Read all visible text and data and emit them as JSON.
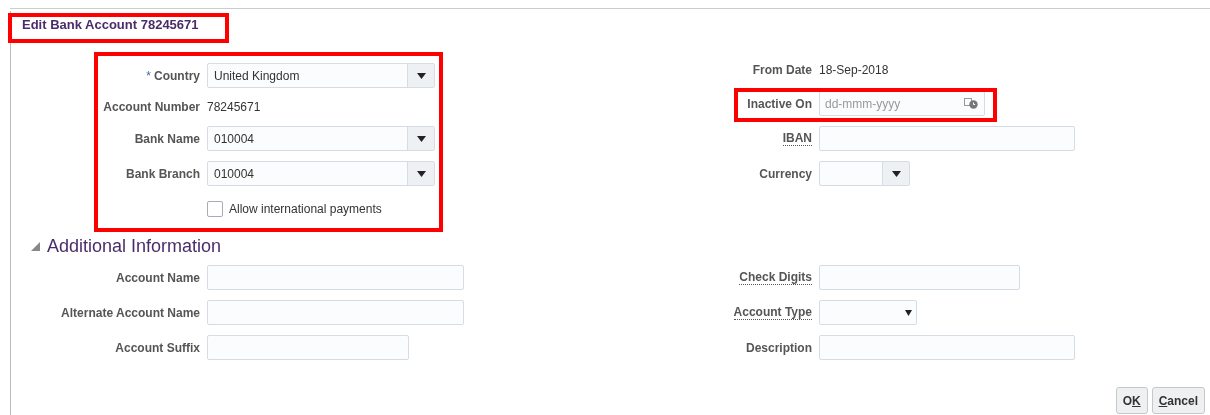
{
  "title": "Edit Bank Account 78245671",
  "main_left": [
    {
      "kind": "select",
      "required_mark": "*",
      "label": "Country",
      "value": "United Kingdom",
      "help": false
    },
    {
      "kind": "text",
      "label": "Account Number",
      "value": "78245671",
      "help": false
    },
    {
      "kind": "select",
      "label": "Bank Name",
      "value": "010004",
      "help": false
    },
    {
      "kind": "select",
      "label": "Bank Branch",
      "value": "010004",
      "help": false
    },
    {
      "kind": "checkbox",
      "label": "Allow international payments",
      "checked": false
    }
  ],
  "main_right": [
    {
      "kind": "text",
      "label": "From Date",
      "value": "18-Sep-2018",
      "help": false
    },
    {
      "kind": "date",
      "label": "Inactive On",
      "placeholder": "dd-mmm-yyyy",
      "help": false
    },
    {
      "kind": "input",
      "label": "IBAN",
      "help": true
    },
    {
      "kind": "select",
      "label": "Currency",
      "help": false
    }
  ],
  "section": {
    "title": "Additional Information",
    "expanded": true
  },
  "additional_left": [
    {
      "kind": "input",
      "label": "Account Name",
      "help": false
    },
    {
      "kind": "input",
      "label": "Alternate Account Name",
      "help": false
    },
    {
      "kind": "input",
      "label": "Account Suffix",
      "help": false
    }
  ],
  "additional_right": [
    {
      "kind": "input",
      "label": "Check Digits",
      "help": true
    },
    {
      "kind": "choice",
      "label": "Account Type",
      "help": true
    },
    {
      "kind": "input",
      "label": "Description",
      "help": false
    }
  ],
  "buttons": [
    {
      "before": "O",
      "key": "K"
    },
    {
      "key": "C",
      "after": "ancel"
    }
  ]
}
